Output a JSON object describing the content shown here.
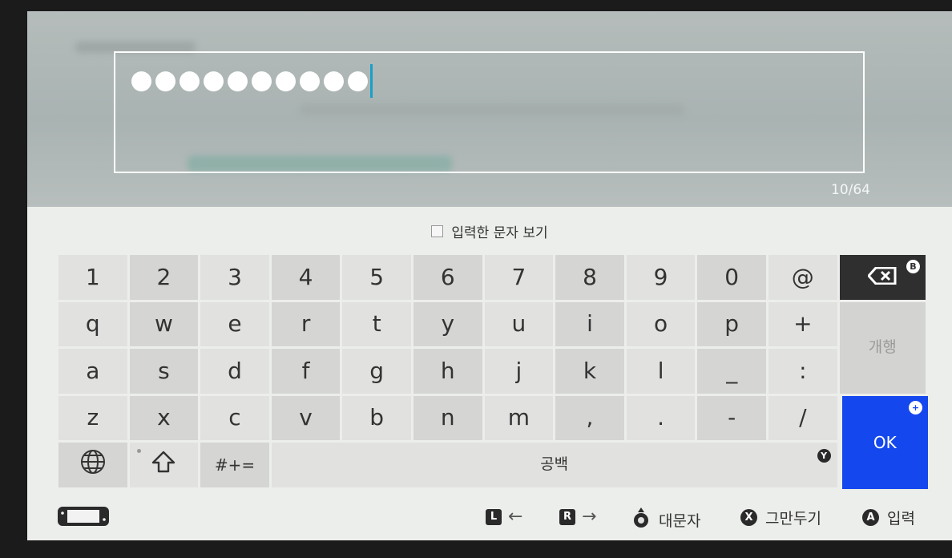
{
  "password_field": {
    "dot_count": 10,
    "char_count": "10/64"
  },
  "show_characters_label": "입력한 문자 보기",
  "keyboard": {
    "rows": [
      [
        "1",
        "2",
        "3",
        "4",
        "5",
        "6",
        "7",
        "8",
        "9",
        "0",
        "@"
      ],
      [
        "q",
        "w",
        "e",
        "r",
        "t",
        "y",
        "u",
        "i",
        "o",
        "p",
        "+"
      ],
      [
        "a",
        "s",
        "d",
        "f",
        "g",
        "h",
        "j",
        "k",
        "l",
        "_",
        ":"
      ],
      [
        "z",
        "x",
        "c",
        "v",
        "b",
        "n",
        "m",
        ",",
        ".",
        "-",
        "/"
      ]
    ],
    "symbols_label": "#+=",
    "space_label": "공백",
    "newline_label": "개행",
    "ok_label": "OK",
    "backspace_badge": "B",
    "ok_badge": "+",
    "space_badge": "Y"
  },
  "hints": {
    "l_button": "L",
    "r_button": "R",
    "caps_label": "대문자",
    "x_button": "X",
    "cancel_label": "그만두기",
    "a_button": "A",
    "enter_label": "입력"
  },
  "colors": {
    "ok_key": "#1448ee",
    "cursor": "#1aa0c6",
    "backspace_key": "#2f2f2f"
  }
}
